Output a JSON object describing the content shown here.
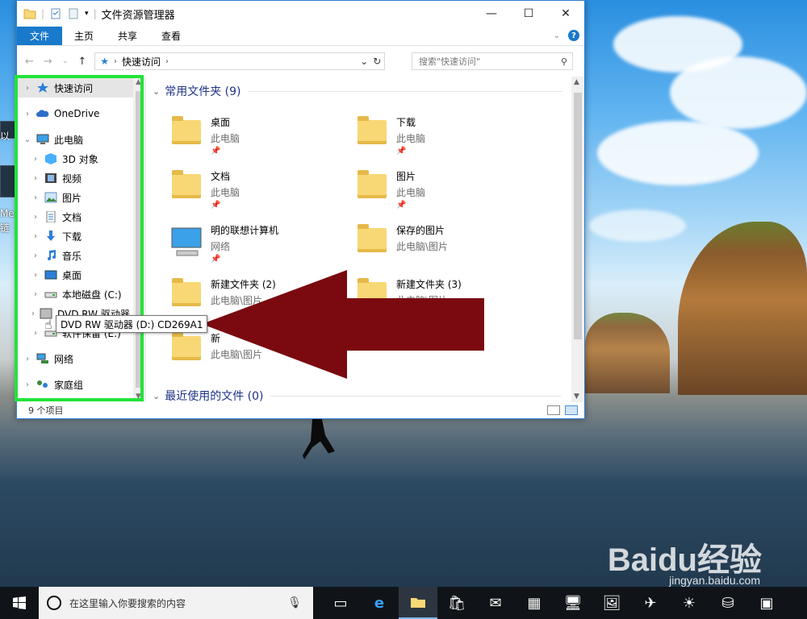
{
  "window": {
    "title": "文件资源管理器",
    "min_glyph": "—",
    "max_glyph": "☐",
    "close_glyph": "✕"
  },
  "ribbon": {
    "tabs": [
      "文件",
      "主页",
      "共享",
      "查看"
    ],
    "help": "?"
  },
  "address": {
    "path": "快速访问",
    "search_placeholder": "搜索\"快速访问\""
  },
  "nav_pane": {
    "items": [
      {
        "label": "快速访问",
        "icon": "star-icon",
        "level": 0,
        "selected": true
      },
      {
        "label": "OneDrive",
        "icon": "cloud-icon",
        "level": 0
      },
      {
        "label": "此电脑",
        "icon": "computer-icon",
        "level": 0,
        "expanded": true
      },
      {
        "label": "3D 对象",
        "icon": "cube-icon",
        "level": 1
      },
      {
        "label": "视频",
        "icon": "video-icon",
        "level": 1
      },
      {
        "label": "图片",
        "icon": "picture-icon",
        "level": 1
      },
      {
        "label": "文档",
        "icon": "document-icon",
        "level": 1
      },
      {
        "label": "下载",
        "icon": "download-icon",
        "level": 1
      },
      {
        "label": "音乐",
        "icon": "music-icon",
        "level": 1
      },
      {
        "label": "桌面",
        "icon": "desktop-icon",
        "level": 1
      },
      {
        "label": "本地磁盘 (C:)",
        "icon": "drive-icon",
        "level": 1
      },
      {
        "label": "DVD RW 驱动器 (D:) CD269A1",
        "icon": "dvd-icon",
        "level": 1
      },
      {
        "label": "软件保留 (E:)",
        "icon": "drive-icon",
        "level": 1
      },
      {
        "label": "网络",
        "icon": "network-icon",
        "level": 0
      },
      {
        "label": "家庭组",
        "icon": "homegroup-icon",
        "level": 0
      }
    ]
  },
  "tooltip": "DVD RW 驱动器 (D:) CD269A1",
  "frequent": {
    "header": "常用文件夹 (9)",
    "items": [
      {
        "name": "桌面",
        "path": "此电脑",
        "pinned": true
      },
      {
        "name": "下载",
        "path": "此电脑",
        "pinned": true
      },
      {
        "name": "文档",
        "path": "此电脑",
        "pinned": true
      },
      {
        "name": "图片",
        "path": "此电脑",
        "pinned": true
      },
      {
        "name": "明的联想计算机",
        "path": "网络",
        "pinned": true
      },
      {
        "name": "保存的图片",
        "path": "此电脑\\图片",
        "pinned": false
      },
      {
        "name": "新建文件夹 (2)",
        "path": "此电脑\\图片",
        "pinned": false
      },
      {
        "name": "新建文件夹 (3)",
        "path": "此电脑\\图片",
        "pinned": false
      },
      {
        "name": "新",
        "path": "此电脑\\图片",
        "pinned": false
      }
    ]
  },
  "recent": {
    "header": "最近使用的文件 (0)"
  },
  "status": {
    "count": "9 个项目"
  },
  "taskbar": {
    "search_placeholder": "在这里输入你要搜索的内容"
  },
  "desktop": {
    "icon_texts": [
      "以",
      "Me",
      "链"
    ]
  },
  "watermark": {
    "brand": "Baidu经验",
    "url": "jingyan.baidu.com"
  },
  "colors": {
    "accent": "#1979ca",
    "highlight_box": "#22e339",
    "arrow": "#7a0a10"
  }
}
